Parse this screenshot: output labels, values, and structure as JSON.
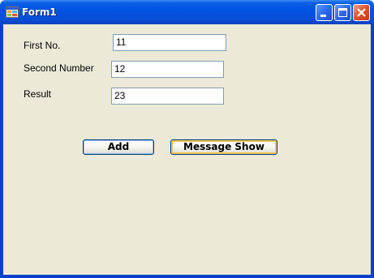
{
  "window": {
    "title": "Form1",
    "icon": "form-icon",
    "controls": [
      "minimize-icon",
      "maximize-icon",
      "close-icon"
    ]
  },
  "form": {
    "first": {
      "label": "First No.",
      "value": "11"
    },
    "second": {
      "label": "Second Number",
      "value": "12"
    },
    "result": {
      "label": "Result",
      "value": "23"
    },
    "buttons": {
      "add": "Add",
      "message": "Message Show"
    }
  },
  "colors": {
    "titlebar": "#0054e3",
    "client": "#ece9d8",
    "close_button": "#e0512a",
    "focus_border": "#f5c25a"
  }
}
